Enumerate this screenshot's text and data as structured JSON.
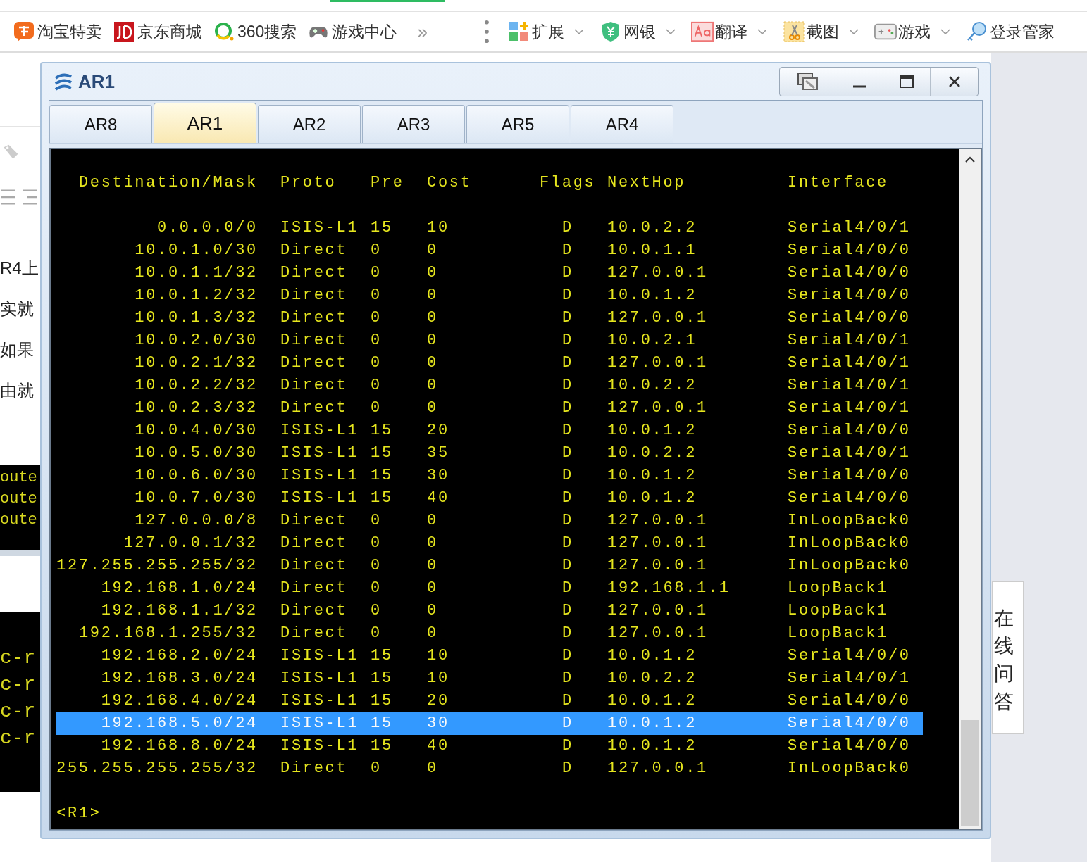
{
  "browser_bar": {
    "bookmarks": [
      {
        "label": "淘宝特卖",
        "kind": "taobao"
      },
      {
        "label": "京东商城",
        "kind": "jd"
      },
      {
        "label": "360搜索",
        "kind": "search360"
      },
      {
        "label": "游戏中心",
        "kind": "gamepad"
      }
    ],
    "more": "»",
    "tools": [
      {
        "label": "扩展",
        "kind": "apps"
      },
      {
        "label": "网银",
        "kind": "shield"
      },
      {
        "label": "翻译",
        "kind": "translate"
      },
      {
        "label": "截图",
        "kind": "scissors"
      },
      {
        "label": "游戏",
        "kind": "game"
      }
    ],
    "login": "登录管家"
  },
  "left_article": {
    "lines": [
      "R4上",
      "实就",
      "如果",
      "由就"
    ],
    "code_block_1": [
      "oute",
      "oute",
      "oute"
    ],
    "code_block_2": [
      "c-r",
      "c-r",
      "c-r",
      "c-r"
    ]
  },
  "window": {
    "title": "AR1",
    "tabs": [
      {
        "label": "AR8",
        "selected": false
      },
      {
        "label": "AR1",
        "selected": true
      },
      {
        "label": "AR2",
        "selected": false
      },
      {
        "label": "AR3",
        "selected": false
      },
      {
        "label": "AR5",
        "selected": false
      },
      {
        "label": "AR4",
        "selected": false
      }
    ],
    "terminal": {
      "columns": [
        "Destination/Mask",
        "Proto",
        "Pre",
        "Cost",
        "Flags",
        "NextHop",
        "Interface"
      ],
      "rows": [
        {
          "dest": "0.0.0.0/0",
          "proto": "ISIS-L1",
          "pre": "15",
          "cost": "10",
          "flags": "D",
          "nexthop": "10.0.2.2",
          "interface": "Serial4/0/1",
          "selected": false
        },
        {
          "dest": "10.0.1.0/30",
          "proto": "Direct",
          "pre": "0",
          "cost": "0",
          "flags": "D",
          "nexthop": "10.0.1.1",
          "interface": "Serial4/0/0",
          "selected": false
        },
        {
          "dest": "10.0.1.1/32",
          "proto": "Direct",
          "pre": "0",
          "cost": "0",
          "flags": "D",
          "nexthop": "127.0.0.1",
          "interface": "Serial4/0/0",
          "selected": false
        },
        {
          "dest": "10.0.1.2/32",
          "proto": "Direct",
          "pre": "0",
          "cost": "0",
          "flags": "D",
          "nexthop": "10.0.1.2",
          "interface": "Serial4/0/0",
          "selected": false
        },
        {
          "dest": "10.0.1.3/32",
          "proto": "Direct",
          "pre": "0",
          "cost": "0",
          "flags": "D",
          "nexthop": "127.0.0.1",
          "interface": "Serial4/0/0",
          "selected": false
        },
        {
          "dest": "10.0.2.0/30",
          "proto": "Direct",
          "pre": "0",
          "cost": "0",
          "flags": "D",
          "nexthop": "10.0.2.1",
          "interface": "Serial4/0/1",
          "selected": false
        },
        {
          "dest": "10.0.2.1/32",
          "proto": "Direct",
          "pre": "0",
          "cost": "0",
          "flags": "D",
          "nexthop": "127.0.0.1",
          "interface": "Serial4/0/1",
          "selected": false
        },
        {
          "dest": "10.0.2.2/32",
          "proto": "Direct",
          "pre": "0",
          "cost": "0",
          "flags": "D",
          "nexthop": "10.0.2.2",
          "interface": "Serial4/0/1",
          "selected": false
        },
        {
          "dest": "10.0.2.3/32",
          "proto": "Direct",
          "pre": "0",
          "cost": "0",
          "flags": "D",
          "nexthop": "127.0.0.1",
          "interface": "Serial4/0/1",
          "selected": false
        },
        {
          "dest": "10.0.4.0/30",
          "proto": "ISIS-L1",
          "pre": "15",
          "cost": "20",
          "flags": "D",
          "nexthop": "10.0.1.2",
          "interface": "Serial4/0/0",
          "selected": false
        },
        {
          "dest": "10.0.5.0/30",
          "proto": "ISIS-L1",
          "pre": "15",
          "cost": "35",
          "flags": "D",
          "nexthop": "10.0.2.2",
          "interface": "Serial4/0/1",
          "selected": false
        },
        {
          "dest": "10.0.6.0/30",
          "proto": "ISIS-L1",
          "pre": "15",
          "cost": "30",
          "flags": "D",
          "nexthop": "10.0.1.2",
          "interface": "Serial4/0/0",
          "selected": false
        },
        {
          "dest": "10.0.7.0/30",
          "proto": "ISIS-L1",
          "pre": "15",
          "cost": "40",
          "flags": "D",
          "nexthop": "10.0.1.2",
          "interface": "Serial4/0/0",
          "selected": false
        },
        {
          "dest": "127.0.0.0/8",
          "proto": "Direct",
          "pre": "0",
          "cost": "0",
          "flags": "D",
          "nexthop": "127.0.0.1",
          "interface": "InLoopBack0",
          "selected": false
        },
        {
          "dest": "127.0.0.1/32",
          "proto": "Direct",
          "pre": "0",
          "cost": "0",
          "flags": "D",
          "nexthop": "127.0.0.1",
          "interface": "InLoopBack0",
          "selected": false
        },
        {
          "dest": "127.255.255.255/32",
          "proto": "Direct",
          "pre": "0",
          "cost": "0",
          "flags": "D",
          "nexthop": "127.0.0.1",
          "interface": "InLoopBack0",
          "selected": false
        },
        {
          "dest": "192.168.1.0/24",
          "proto": "Direct",
          "pre": "0",
          "cost": "0",
          "flags": "D",
          "nexthop": "192.168.1.1",
          "interface": "LoopBack1",
          "selected": false
        },
        {
          "dest": "192.168.1.1/32",
          "proto": "Direct",
          "pre": "0",
          "cost": "0",
          "flags": "D",
          "nexthop": "127.0.0.1",
          "interface": "LoopBack1",
          "selected": false
        },
        {
          "dest": "192.168.1.255/32",
          "proto": "Direct",
          "pre": "0",
          "cost": "0",
          "flags": "D",
          "nexthop": "127.0.0.1",
          "interface": "LoopBack1",
          "selected": false
        },
        {
          "dest": "192.168.2.0/24",
          "proto": "ISIS-L1",
          "pre": "15",
          "cost": "10",
          "flags": "D",
          "nexthop": "10.0.1.2",
          "interface": "Serial4/0/0",
          "selected": false
        },
        {
          "dest": "192.168.3.0/24",
          "proto": "ISIS-L1",
          "pre": "15",
          "cost": "10",
          "flags": "D",
          "nexthop": "10.0.2.2",
          "interface": "Serial4/0/1",
          "selected": false
        },
        {
          "dest": "192.168.4.0/24",
          "proto": "ISIS-L1",
          "pre": "15",
          "cost": "20",
          "flags": "D",
          "nexthop": "10.0.1.2",
          "interface": "Serial4/0/0",
          "selected": false
        },
        {
          "dest": "192.168.5.0/24",
          "proto": "ISIS-L1",
          "pre": "15",
          "cost": "30",
          "flags": "D",
          "nexthop": "10.0.1.2",
          "interface": "Serial4/0/0",
          "selected": true
        },
        {
          "dest": "192.168.8.0/24",
          "proto": "ISIS-L1",
          "pre": "15",
          "cost": "40",
          "flags": "D",
          "nexthop": "10.0.1.2",
          "interface": "Serial4/0/0",
          "selected": false
        },
        {
          "dest": "255.255.255.255/32",
          "proto": "Direct",
          "pre": "0",
          "cost": "0",
          "flags": "D",
          "nexthop": "127.0.0.1",
          "interface": "InLoopBack0",
          "selected": false
        }
      ],
      "prompt": "<R1>"
    }
  },
  "side_panel": {
    "label": "在线问答"
  }
}
